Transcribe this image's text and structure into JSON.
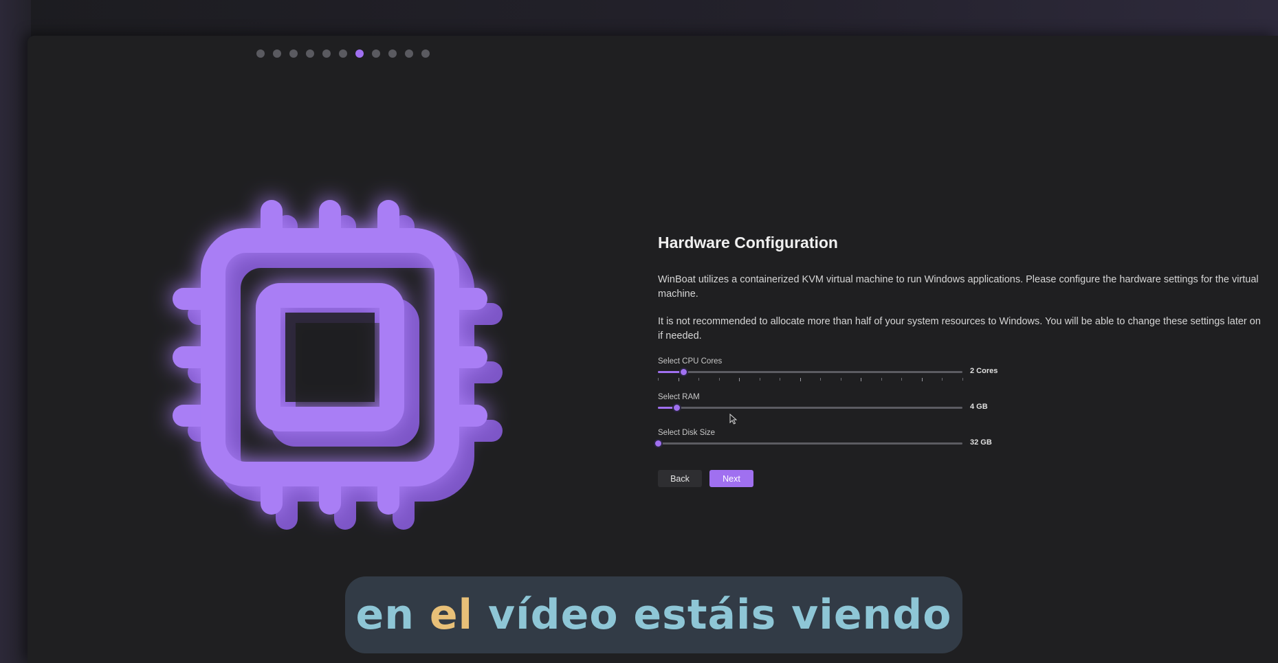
{
  "step_indicator": {
    "total": 11,
    "active_index": 6
  },
  "colors": {
    "accent": "#a070f0",
    "window_bg": "#1f1f21",
    "subtitle_bg": "#343e48",
    "subtitle_text": "#8ec6d6",
    "subtitle_highlight": "#e8c078"
  },
  "illustration": {
    "icon": "cpu-chip-icon"
  },
  "hardware": {
    "title": "Hardware Configuration",
    "description_1": "WinBoat utilizes a containerized KVM virtual machine to run Windows applications. Please configure the hardware settings for the virtual machine.",
    "description_2": "It is not recommended to allocate more than half of your system resources to Windows. You will be able to change these settings later on if needed.",
    "sliders": [
      {
        "label": "Select CPU Cores",
        "value_text": "2 Cores",
        "fraction": 0.083,
        "ticks": 16
      },
      {
        "label": "Select RAM",
        "value_text": "4 GB",
        "fraction": 0.06
      },
      {
        "label": "Select Disk Size",
        "value_text": "32 GB",
        "fraction": 0.0
      }
    ],
    "back_label": "Back",
    "next_label": "Next"
  },
  "subtitle": {
    "before": "en ",
    "highlight": "el",
    "after": " vídeo estáis viendo"
  }
}
